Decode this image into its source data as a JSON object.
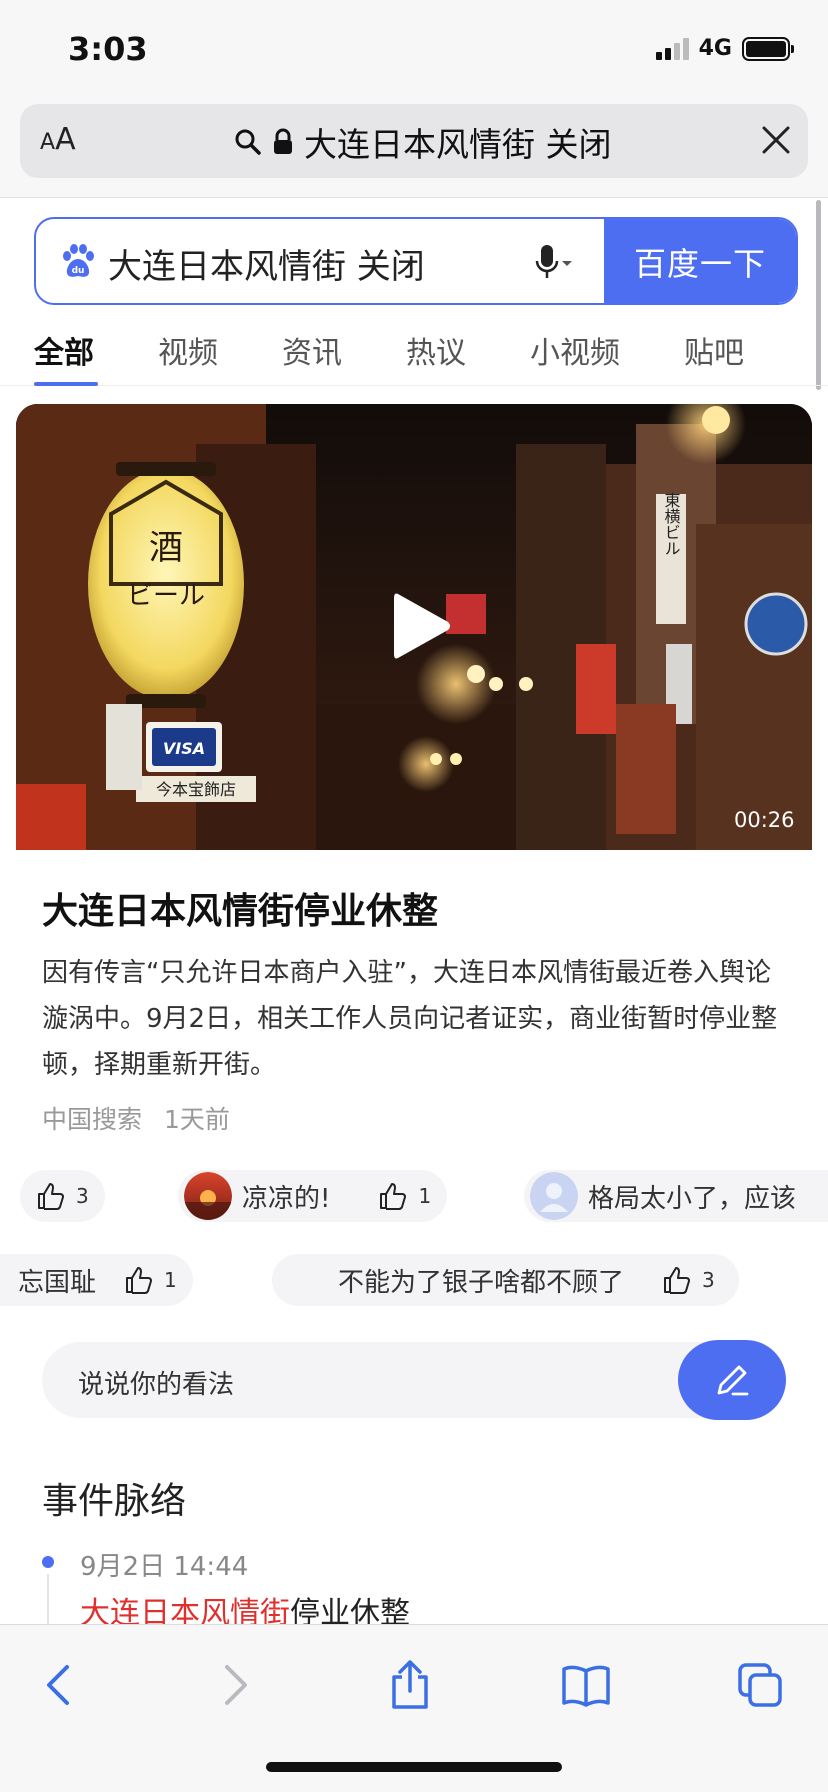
{
  "status_bar": {
    "time": "3:03",
    "network": "4G",
    "battery_level": 1.0
  },
  "safari": {
    "aa_small": "A",
    "aa_large": "A",
    "address": "大连日本风情街 关闭"
  },
  "search": {
    "query": "大连日本风情街 关闭",
    "button_label": "百度一下"
  },
  "tabs": [
    {
      "label": "全部",
      "active": true
    },
    {
      "label": "视频"
    },
    {
      "label": "资讯"
    },
    {
      "label": "热议"
    },
    {
      "label": "小视频"
    },
    {
      "label": "贴吧"
    }
  ],
  "video": {
    "duration": "00:26",
    "sign_visa": "VISA",
    "sign_shop": "今本宝飾店",
    "sign_building": "東横ビル"
  },
  "news": {
    "title": "大连日本风情街停业休整",
    "body": "因有传言“只允许日本商户入驻”，大连日本风情街最近卷入舆论漩涡中。9月2日，相关工作人员向记者证实，商业街暂时停业整顿，择期重新开街。",
    "source": "中国搜索",
    "time": "1天前"
  },
  "comments_row1": [
    {
      "text": "",
      "likes": "3"
    },
    {
      "text": "凉凉的!",
      "likes": "1"
    },
    {
      "text": "格局太小了，应该"
    }
  ],
  "comments_row2": [
    {
      "text": "忘国耻",
      "likes": "1"
    },
    {
      "text": "不能为了银子啥都不顾了",
      "likes": "3"
    }
  ],
  "comment_input": {
    "placeholder": "说说你的看法"
  },
  "timeline": {
    "title": "事件脉络",
    "items": [
      {
        "time": "9月2日 14:44",
        "highlight": "大连日本风情街",
        "rest": "停业休整"
      }
    ]
  },
  "colors": {
    "brand_blue": "#4e6ef2",
    "highlight_red": "#e0302e"
  },
  "icons": [
    "search-icon",
    "lock-icon",
    "close-icon",
    "baidu-logo-icon",
    "mic-icon",
    "play-icon",
    "thumb-up-icon",
    "pencil-icon",
    "back-icon",
    "forward-icon",
    "share-icon",
    "bookmarks-icon",
    "tabs-icon"
  ]
}
